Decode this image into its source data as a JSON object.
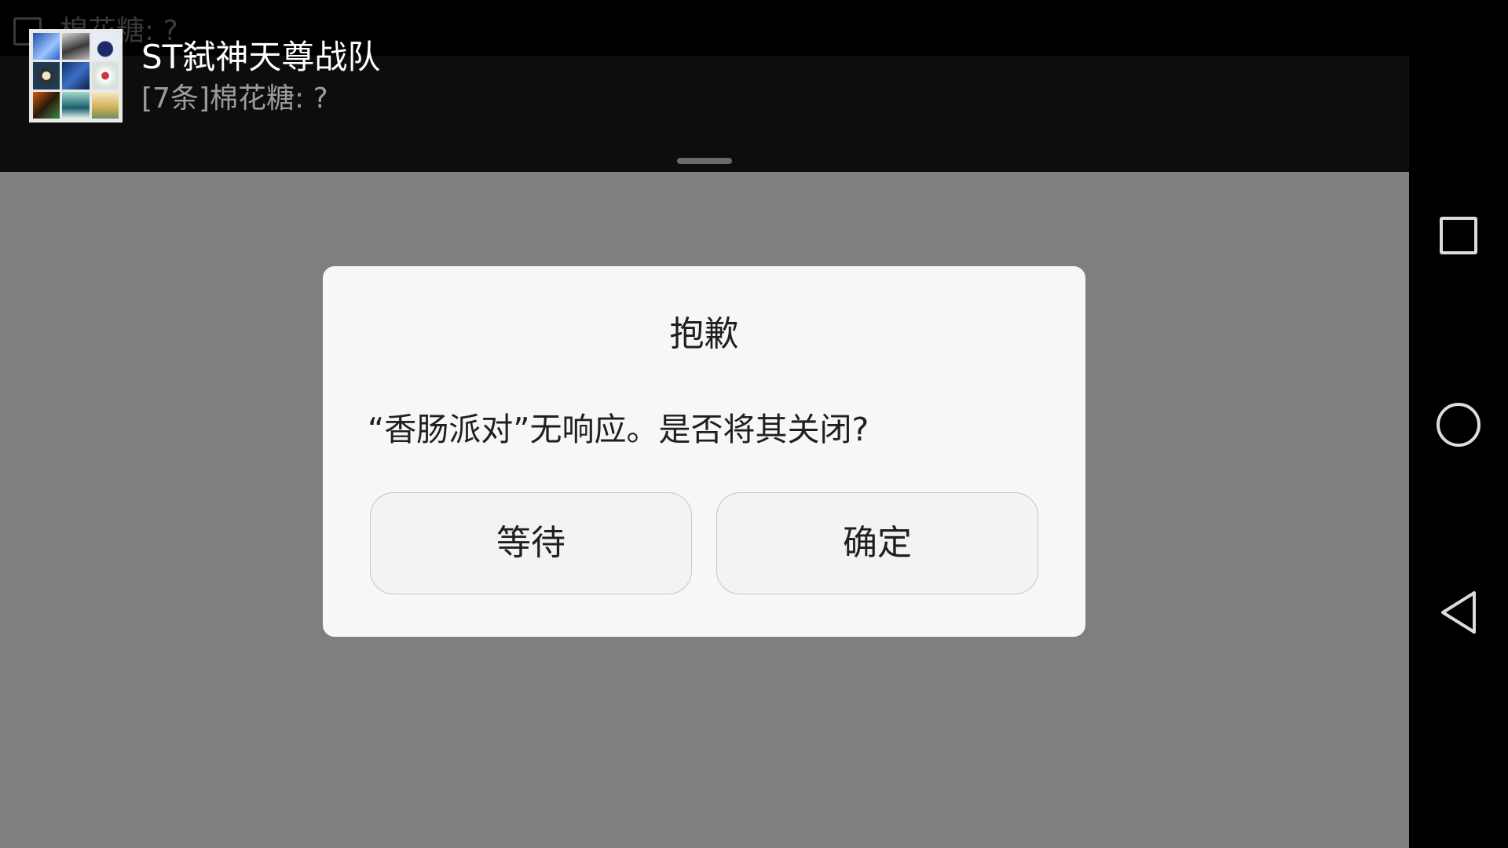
{
  "status_bar": {
    "ticker_icon": "message-icon",
    "ticker_text": "棉花糖: ?"
  },
  "notification": {
    "avatar_icon": "group-avatar-icon",
    "title": "ST弑神天尊战队",
    "subtitle": "[7条]棉花糖: ?"
  },
  "dialog": {
    "title": "抱歉",
    "message": "“香肠派对”无响应。是否将其关闭?",
    "buttons": [
      {
        "label": "等待"
      },
      {
        "label": "确定"
      }
    ]
  },
  "nav_bar": {
    "items": [
      {
        "icon": "recents-square-icon"
      },
      {
        "icon": "home-circle-icon"
      },
      {
        "icon": "back-triangle-icon"
      }
    ]
  },
  "colors": {
    "scrim": "#7f7f7f",
    "dialog-bg": "#f7f7f7",
    "button-bg": "#f3f3f3",
    "button-border": "#c6c6c6",
    "text-dark": "#1f1f1f",
    "notif-bg": "#0d0d0d",
    "nav-icon": "#dcdcdc"
  }
}
